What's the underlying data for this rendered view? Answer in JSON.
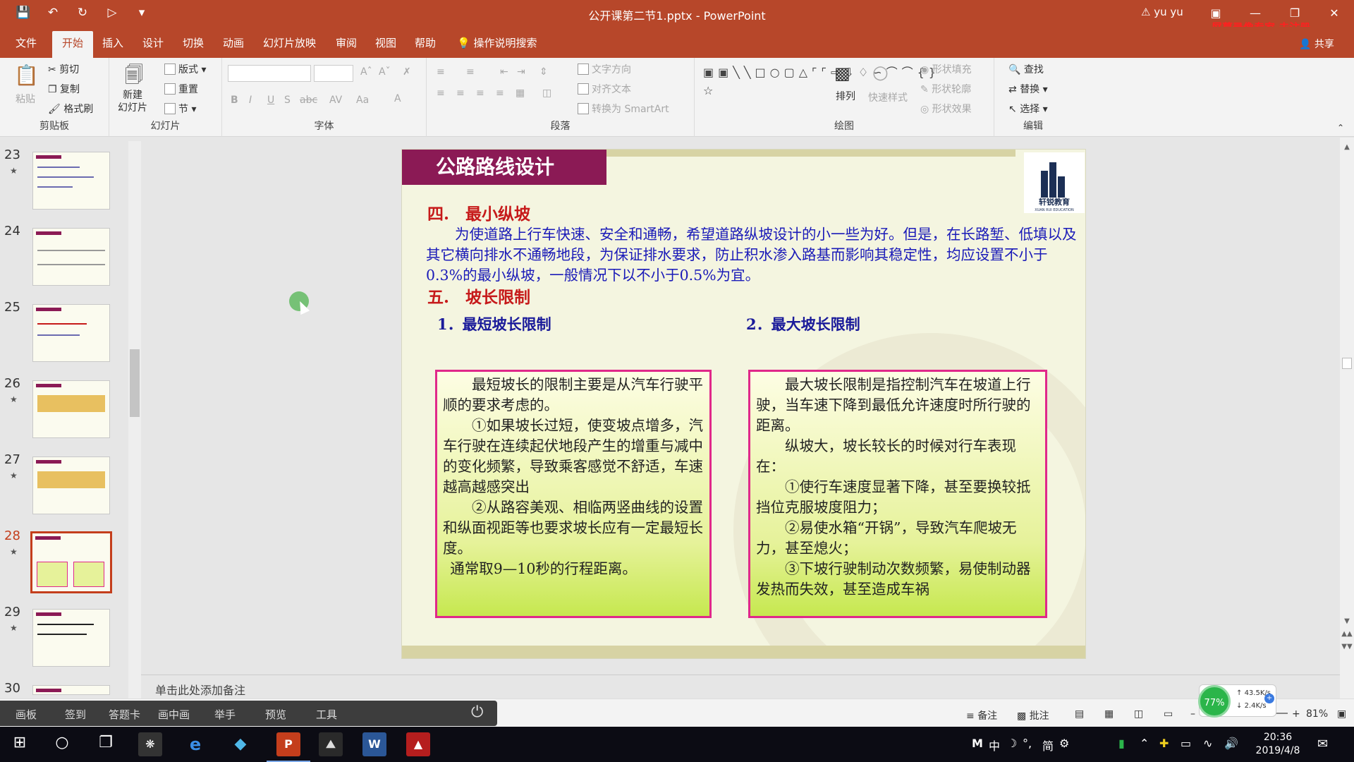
{
  "window": {
    "title": "公开课第二节1.pptx - PowerPoint",
    "user": "yu yu",
    "watermark": "屏幕录像专家 未注册",
    "share": "共享"
  },
  "tabs": [
    "文件",
    "开始",
    "插入",
    "设计",
    "切换",
    "动画",
    "幻灯片放映",
    "审阅",
    "视图",
    "帮助",
    "操作说明搜索"
  ],
  "ribbon": {
    "clipboard": {
      "paste": "粘贴",
      "cut": "剪切",
      "copy": "复制",
      "format_painter": "格式刷",
      "label": "剪贴板"
    },
    "slides": {
      "new_slide": "新建\n幻灯片",
      "layout": "版式",
      "reset": "重置",
      "section": "节",
      "label": "幻灯片"
    },
    "font": {
      "label": "字体"
    },
    "paragraph": {
      "text_direction": "文字方向",
      "align_text": "对齐文本",
      "smartart": "转换为 SmartArt",
      "label": "段落"
    },
    "drawing": {
      "arrange": "排列",
      "quick_styles": "快速样式",
      "shape_fill": "形状填充",
      "shape_outline": "形状轮廓",
      "shape_effects": "形状效果",
      "label": "绘图"
    },
    "editing": {
      "find": "查找",
      "replace": "替换",
      "select": "选择",
      "label": "编辑"
    }
  },
  "thumbnails": [
    {
      "num": "23",
      "star": "★"
    },
    {
      "num": "24",
      "star": ""
    },
    {
      "num": "25",
      "star": ""
    },
    {
      "num": "26",
      "star": "★"
    },
    {
      "num": "27",
      "star": "★"
    },
    {
      "num": "28",
      "star": "★"
    },
    {
      "num": "29",
      "star": "★"
    },
    {
      "num": "30",
      "star": ""
    }
  ],
  "slide": {
    "title": "公路路线设计",
    "logo_name": "轩锐教育",
    "logo_sub": "XUAN RUI EDUCATION",
    "section4": "四.　最小纵坡",
    "section4_text": "　　为使道路上行车快速、安全和通畅，希望道路纵坡设计的小一些为好。但是，在长路堑、低填以及其它横向排水不通畅地段，为保证排水要求，防止积水渗入路基而影响其稳定性，均应设置不小于0.3%的最小纵坡，一般情况下以不小于0.5%为宜。",
    "section5": "五.　坡长限制",
    "sub1": "1．最短坡长限制",
    "sub2": "2．最大坡长限制",
    "box1": [
      "最短坡长的限制主要是从汽车行驶平顺的要求考虑的。",
      "①如果坡长过短，使变坡点增多，汽车行驶在连续起伏地段产生的增重与减中的变化频繁，导致乘客感觉不舒适，车速越高越感突出",
      "②从路容美观、相临两竖曲线的设置和纵面视距等也要求坡长应有一定最短长度。",
      "通常取9—10秒的行程距离。"
    ],
    "box2": [
      "最大坡长限制是指控制汽车在坡道上行驶，当车速下降到最低允许速度时所行驶的距离。",
      "纵坡大，坡长较长的时候对行车表现在：",
      "①使行车速度显著下降，甚至要换较抵挡位克服坡度阻力；",
      "②易使水箱“开锅”，导致汽车爬坡无力，甚至熄火；",
      "③下坡行驶制动次数频繁，易使制动器发热而失效，甚至造成车祸"
    ]
  },
  "notes_placeholder": "单击此处添加备注",
  "float_toolbar": [
    "画板",
    "签到",
    "答题卡",
    "画中画",
    "举手",
    "预览",
    "工具"
  ],
  "status": {
    "notes": "备注",
    "comments": "批注",
    "zoom": "81%"
  },
  "netmon": {
    "percent": "77%",
    "up": "43.5K/s",
    "down": "2.4K/s"
  },
  "taskbar": {
    "time": "20:36",
    "date": "2019/4/8",
    "ime": "中",
    "ime2": "简"
  },
  "colors": {
    "accent": "#b7472a",
    "slide_title_bg": "#8b1a55",
    "box_border": "#e0288a",
    "heading_red": "#c61a1a",
    "body_blue": "#1a1ab8"
  }
}
